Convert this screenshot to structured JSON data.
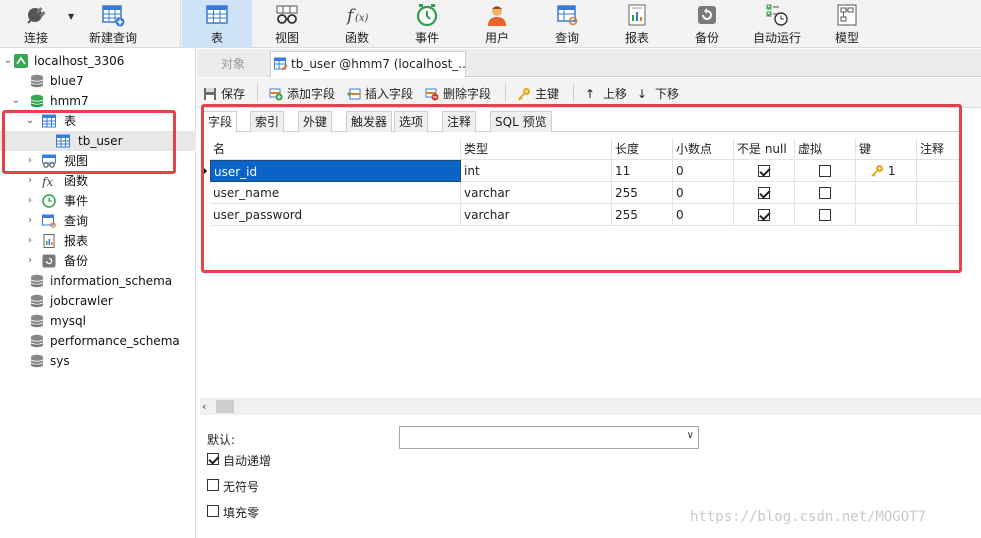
{
  "toolbar": {
    "connect": "连接",
    "new_query": "新建查询",
    "table": "表",
    "view": "视图",
    "function": "函数",
    "event": "事件",
    "user": "用户",
    "query": "查询",
    "report": "报表",
    "backup": "备份",
    "auto_run": "自动运行",
    "model": "模型"
  },
  "tree": {
    "connection": "localhost_3306",
    "db_blue7": "blue7",
    "db_hmm7": "hmm7",
    "node_tables": "表",
    "table_tb_user": "tb_user",
    "node_views": "视图",
    "node_functions": "函数",
    "node_events": "事件",
    "node_queries": "查询",
    "node_reports": "报表",
    "node_backups": "备份",
    "db_information_schema": "information_schema",
    "db_jobcrawler": "jobcrawler",
    "db_mysql": "mysql",
    "db_performance_schema": "performance_schema",
    "db_sys": "sys"
  },
  "tabs": {
    "objects": "对象",
    "current": "tb_user @hmm7 (localhost_..."
  },
  "designer_toolbar": {
    "save": "保存",
    "add_field": "添加字段",
    "insert_field": "插入字段",
    "delete_field": "删除字段",
    "primary_key": "主键",
    "move_up": "上移",
    "move_down": "下移"
  },
  "inner_tabs": {
    "fields": "字段",
    "indexes": "索引",
    "foreign_keys": "外键",
    "triggers": "触发器",
    "options": "选项",
    "comment": "注释",
    "sql_preview": "SQL 预览"
  },
  "grid": {
    "headers": {
      "name": "名",
      "type": "类型",
      "length": "长度",
      "decimals": "小数点",
      "not_null": "不是 null",
      "virtual": "虚拟",
      "key": "键",
      "comment": "注释"
    },
    "rows": [
      {
        "name": "user_id",
        "type": "int",
        "length": "11",
        "decimals": "0",
        "not_null": true,
        "virtual": false,
        "key": "1",
        "comment": ""
      },
      {
        "name": "user_name",
        "type": "varchar",
        "length": "255",
        "decimals": "0",
        "not_null": true,
        "virtual": false,
        "key": "",
        "comment": ""
      },
      {
        "name": "user_password",
        "type": "varchar",
        "length": "255",
        "decimals": "0",
        "not_null": true,
        "virtual": false,
        "key": "",
        "comment": ""
      }
    ]
  },
  "properties": {
    "default_label": "默认:",
    "default_value": "",
    "auto_increment": "自动递增",
    "auto_increment_checked": true,
    "unsigned": "无符号",
    "unsigned_checked": false,
    "zerofill": "填充零",
    "zerofill_checked": false
  },
  "watermark": "https://blog.csdn.net/MOGOT7",
  "colors": {
    "highlight_red": "#e8414a",
    "selection_blue": "#0a64c8",
    "active_tool_bg": "#cfe3f6"
  }
}
